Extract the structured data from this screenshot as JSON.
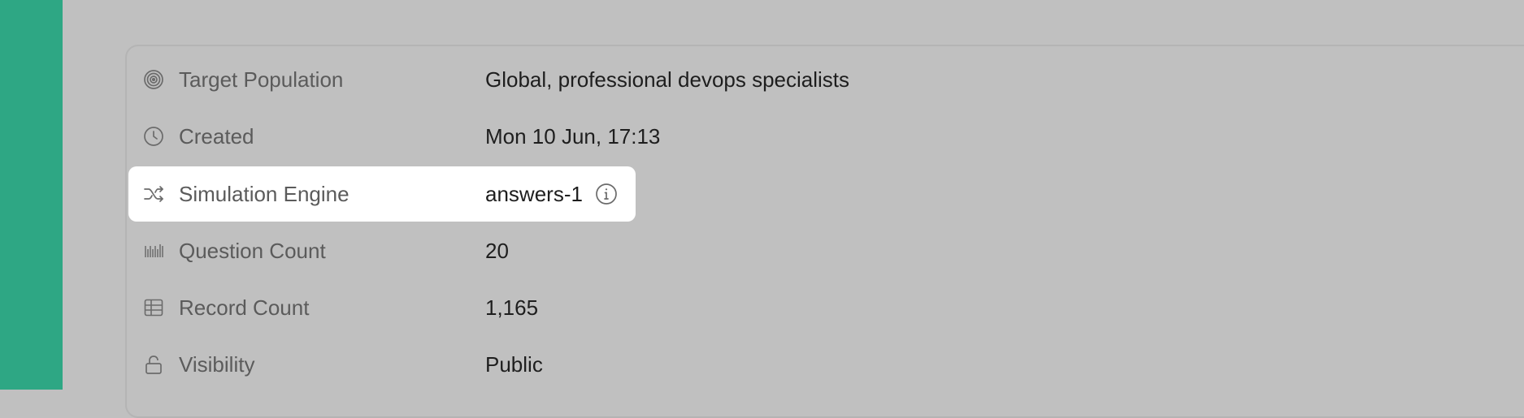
{
  "details": {
    "rows": [
      {
        "icon": "target-icon",
        "label": "Target Population",
        "value": "Global, professional devops specialists"
      },
      {
        "icon": "clock-icon",
        "label": "Created",
        "value": "Mon 10 Jun, 17:13"
      },
      {
        "icon": "shuffle-icon",
        "label": "Simulation Engine",
        "value": "answers-1",
        "highlighted": true,
        "extra_icon": "info-icon"
      },
      {
        "icon": "barcode-icon",
        "label": "Question Count",
        "value": "20"
      },
      {
        "icon": "table-icon",
        "label": "Record Count",
        "value": "1,165"
      },
      {
        "icon": "lock-icon",
        "label": "Visibility",
        "value": "Public"
      }
    ]
  },
  "colors": {
    "accent_sidebar": "#2ea784",
    "overlay_background": "#c0c0c0",
    "highlight_background": "#ffffff"
  }
}
